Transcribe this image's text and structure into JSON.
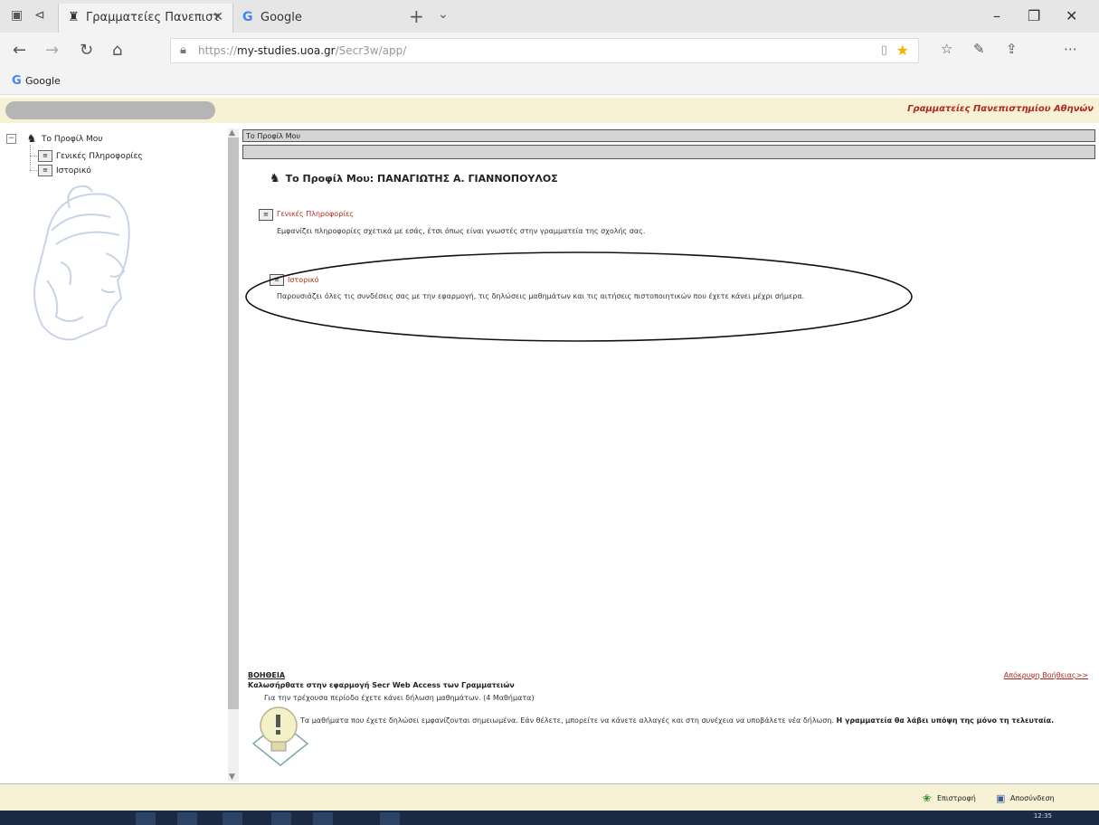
{
  "browser": {
    "tabs": [
      {
        "label": "Γραμματείες Πανεπιστ",
        "icon": "university-icon",
        "active": true
      },
      {
        "label": "Google",
        "icon": "google-icon",
        "active": false
      }
    ],
    "address": {
      "prefix": "https://",
      "domain": "my-studies.uoa.gr",
      "path": "/Secr3w/app/"
    },
    "favorites": [
      {
        "label": "Google",
        "icon": "google-icon"
      }
    ]
  },
  "app": {
    "title": "Γραμματείες Πανεπιστημίου Αθηνών"
  },
  "tree": {
    "root": "Το Προφίλ Μου",
    "children": [
      "Γενικές Πληροφορίες",
      "Ιστορικό"
    ]
  },
  "main": {
    "breadcrumb": "Το Προφίλ Μου",
    "title": "Το Προφίλ Μου: ΠΑΝΑΓΙΩΤΗΣ Α. ΓΙΑΝΝΟΠΟΥΛΟΣ",
    "options": [
      {
        "label": "Γενικές Πληροφορίες",
        "description": "Εμφανίζει πληροφορίες σχετικά με εσάς, έτσι όπως είναι γνωστές στην γραμματεία της σχολής σας."
      },
      {
        "label": "Ιστορικό",
        "description": "Παρουσιάζει όλες τις συνδέσεις σας με την εφαρμογή, τις δηλώσεις μαθημάτων και τις αιτήσεις πιστοποιητικών που έχετε κάνει μέχρι σήμερα."
      }
    ]
  },
  "help": {
    "title": "ΒΟΗΘΕΙΑ",
    "close": "Απόκρυψη Βοήθειας>>",
    "welcome": "Καλωσήρθατε στην εφαρμογή Secr Web Access των Γραμματειών",
    "period": "Για την τρέχουσα περίοδο έχετε κάνει δήλωση μαθημάτων. (4 Μαθήματα)",
    "info": "Τα μαθήματα που έχετε δηλώσει εμφανίζονται σημειωμένα. Εάν θέλετε, μπορείτε να κάνετε αλλαγές και στη συνέχεια να υποβάλετε νέα δήλωση.",
    "info_bold": "Η γραμματεία θα λάβει υπόψη της μόνο τη τελευταία."
  },
  "status": {
    "back": "Επιστροφή",
    "logout": "Αποσύνδεση"
  },
  "taskbar": {
    "time": "12:35"
  }
}
